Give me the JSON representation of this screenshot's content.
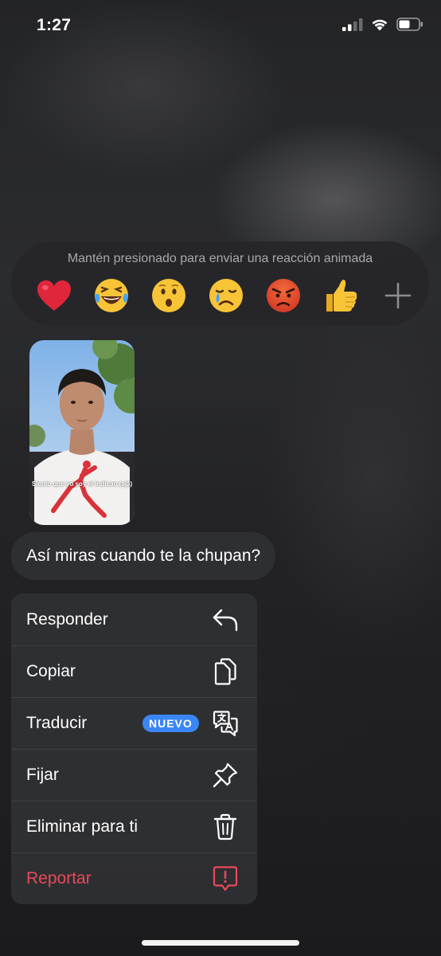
{
  "status_bar": {
    "time": "1:27"
  },
  "reaction_bar": {
    "hint": "Mantén presionado para enviar una reacción animada",
    "reactions": [
      "❤️",
      "😂",
      "😮",
      "😢",
      "😡",
      "👍"
    ],
    "more_icon": "plus-icon"
  },
  "message": {
    "image_caption": "Siento que yo soy el indicao (ajá)",
    "text": "Así miras cuando te la chupan?"
  },
  "menu": {
    "items": [
      {
        "label": "Responder",
        "icon": "reply-icon"
      },
      {
        "label": "Copiar",
        "icon": "copy-icon"
      },
      {
        "label": "Traducir",
        "icon": "translate-icon",
        "badge": "NUEVO"
      },
      {
        "label": "Fijar",
        "icon": "pin-icon"
      },
      {
        "label": "Eliminar para ti",
        "icon": "trash-icon"
      },
      {
        "label": "Reportar",
        "icon": "report-icon"
      }
    ]
  },
  "colors": {
    "danger": "#e9495a",
    "badge": "#3b86f7",
    "menu_background": "#2e2f32"
  }
}
